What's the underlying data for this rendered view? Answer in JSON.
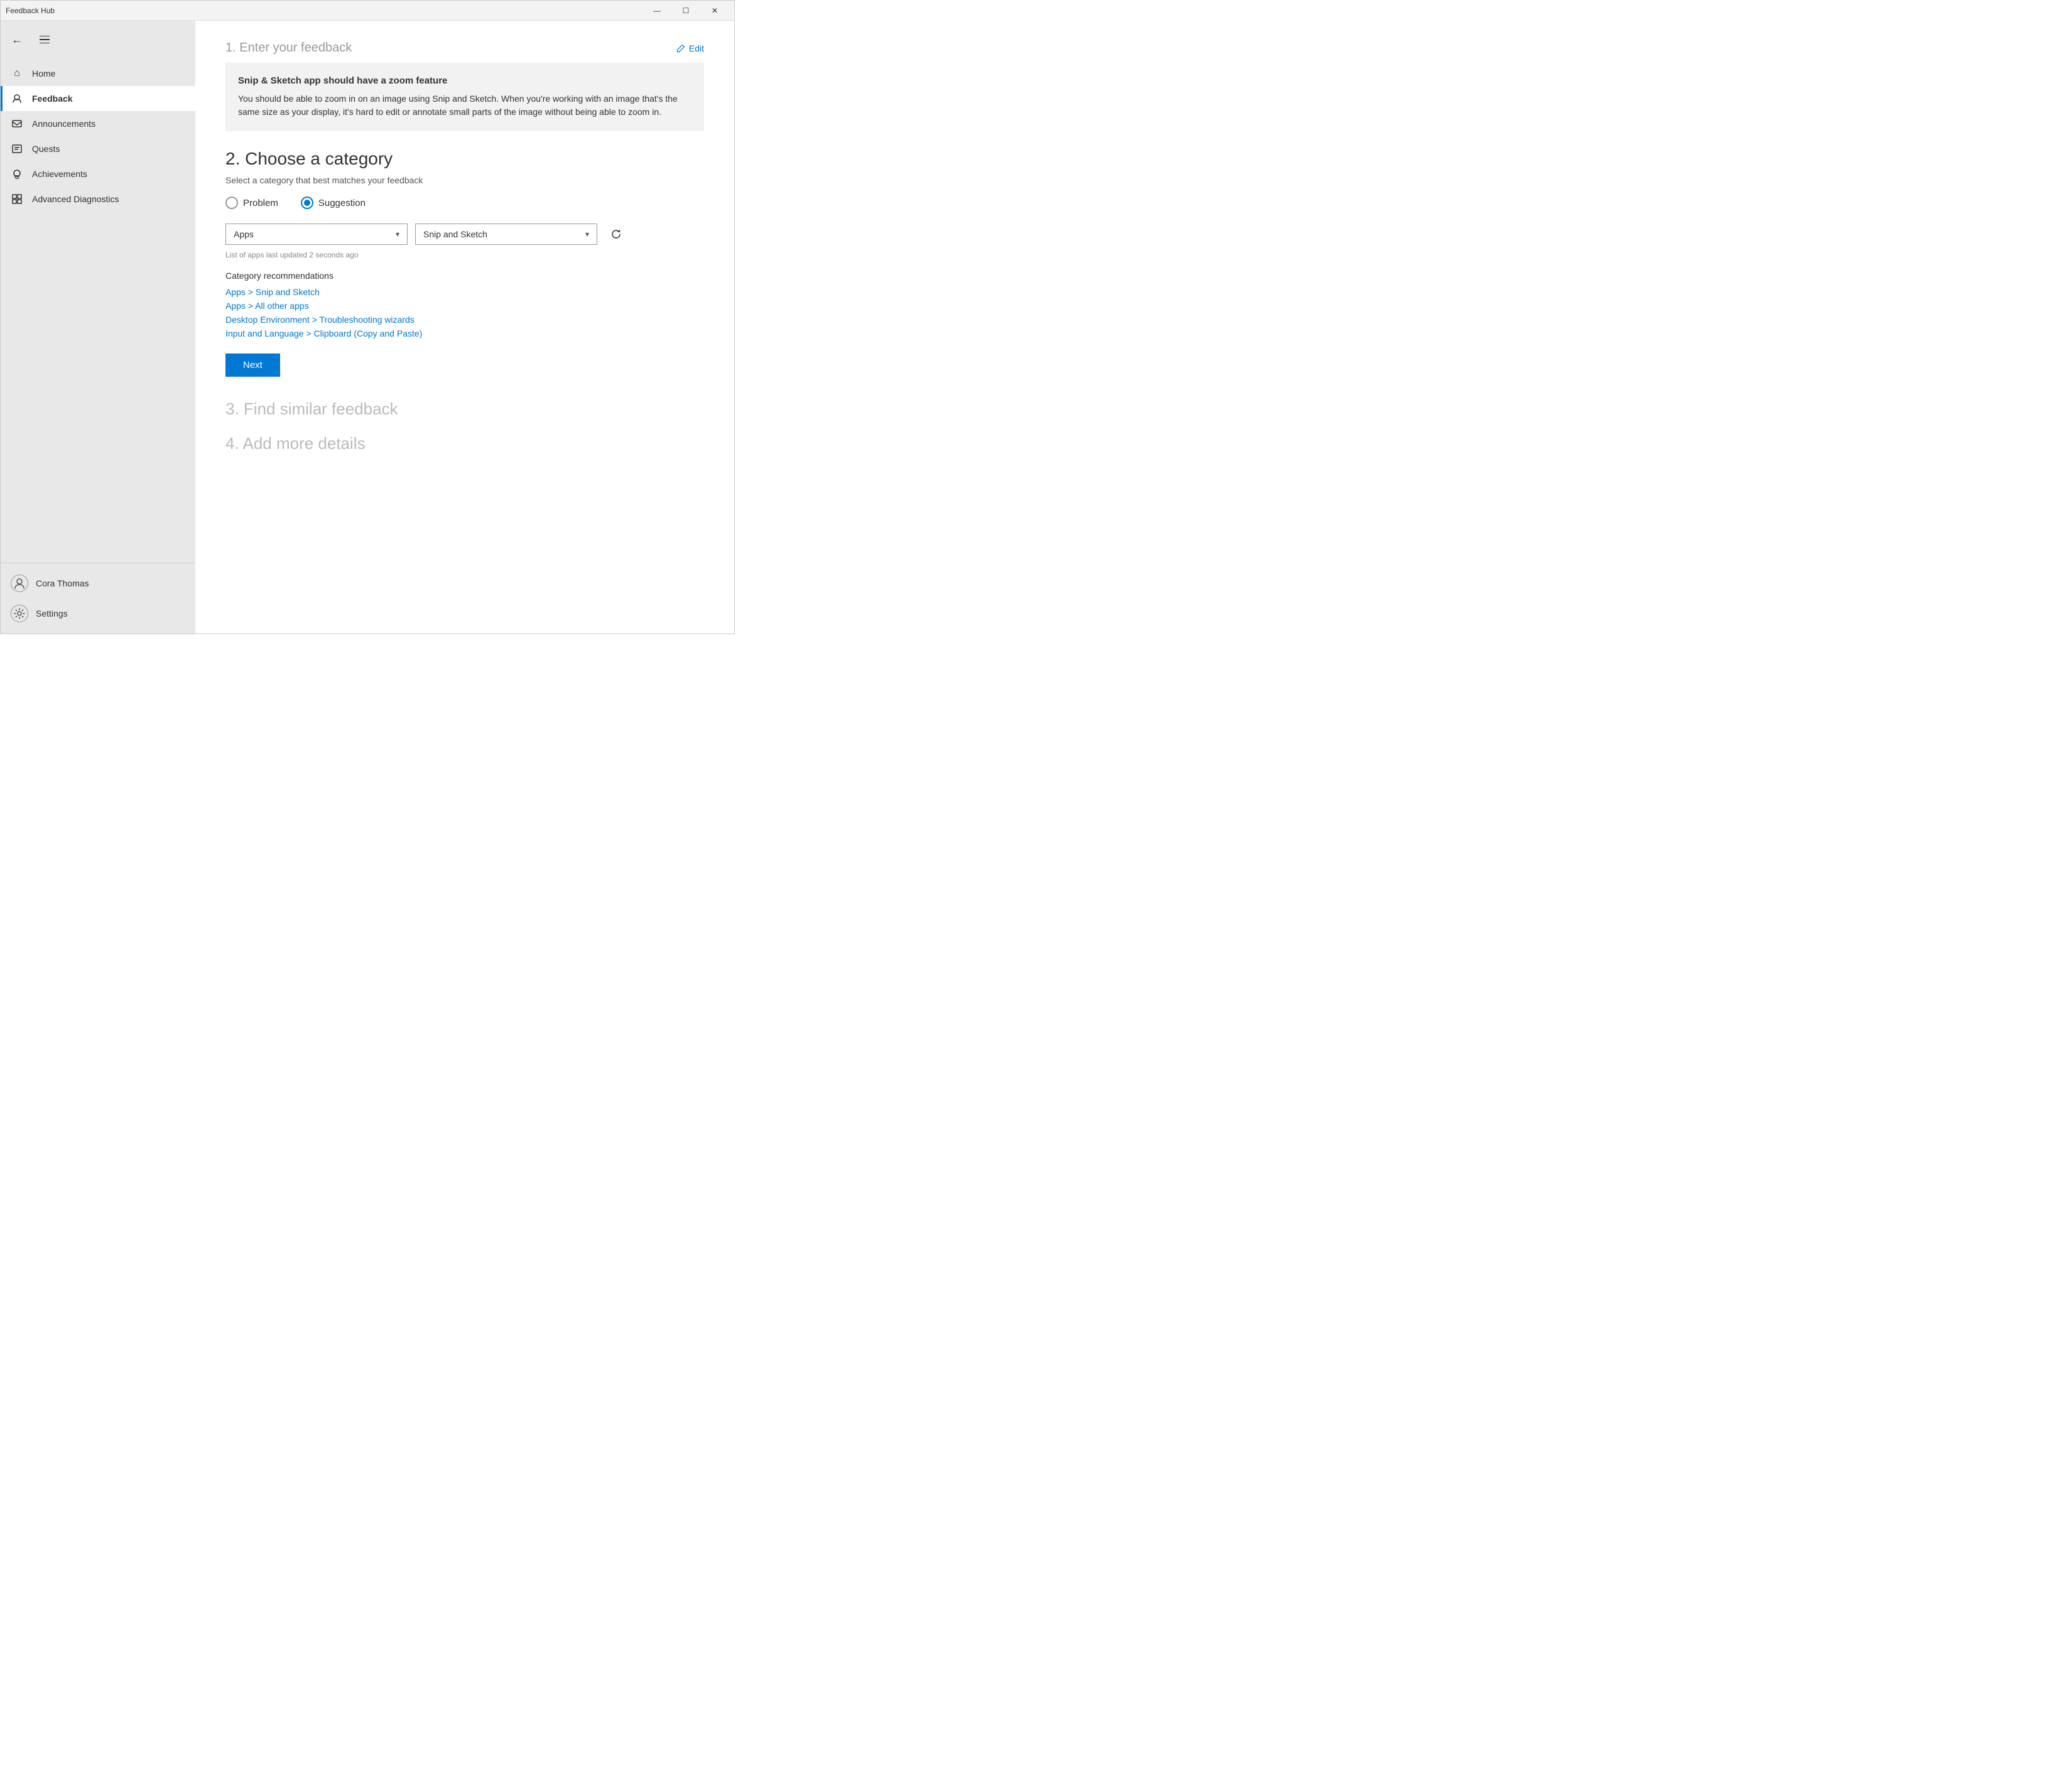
{
  "window": {
    "title": "Feedback Hub",
    "controls": {
      "minimize": "—",
      "maximize": "☐",
      "close": "✕"
    }
  },
  "sidebar": {
    "back_label": "←",
    "hamburger_label": "☰",
    "nav_items": [
      {
        "id": "home",
        "label": "Home",
        "icon": "⌂"
      },
      {
        "id": "feedback",
        "label": "Feedback",
        "icon": "👤",
        "active": true
      },
      {
        "id": "announcements",
        "label": "Announcements",
        "icon": "✉"
      },
      {
        "id": "quests",
        "label": "Quests",
        "icon": "🖥"
      },
      {
        "id": "achievements",
        "label": "Achievements",
        "icon": "🏆"
      },
      {
        "id": "advanced-diagnostics",
        "label": "Advanced Diagnostics",
        "icon": "⧉"
      }
    ],
    "user": {
      "name": "Cora Thomas",
      "icon": "👤"
    },
    "settings": {
      "label": "Settings",
      "icon": "⚙"
    }
  },
  "main": {
    "section1": {
      "number": "1. Enter your feedback",
      "edit_label": "Edit",
      "feedback_title": "Snip & Sketch app should have a zoom feature",
      "feedback_body": "You should be able to zoom in on an image using Snip and Sketch. When you're working with an image that's the same size as your display, it's hard to edit or annotate small parts of the image without being able to zoom in."
    },
    "section2": {
      "number": "2. Choose a category",
      "subtitle": "Select a category that best matches your feedback",
      "radio_options": [
        {
          "id": "problem",
          "label": "Problem",
          "selected": false
        },
        {
          "id": "suggestion",
          "label": "Suggestion",
          "selected": true
        }
      ],
      "category_dropdown": {
        "value": "Apps",
        "arrow": "▾"
      },
      "subcategory_dropdown": {
        "value": "Snip and Sketch",
        "arrow": "▾"
      },
      "list_updated": "List of apps last updated 2 seconds ago",
      "recommendations_title": "Category recommendations",
      "recommendations": [
        "Apps > Snip and Sketch",
        "Apps > All other apps",
        "Desktop Environment > Troubleshooting wizards",
        "Input and Language > Clipboard (Copy and Paste)"
      ],
      "next_label": "Next"
    },
    "section3": {
      "number": "3. Find similar feedback"
    },
    "section4": {
      "number": "4. Add more details"
    }
  }
}
